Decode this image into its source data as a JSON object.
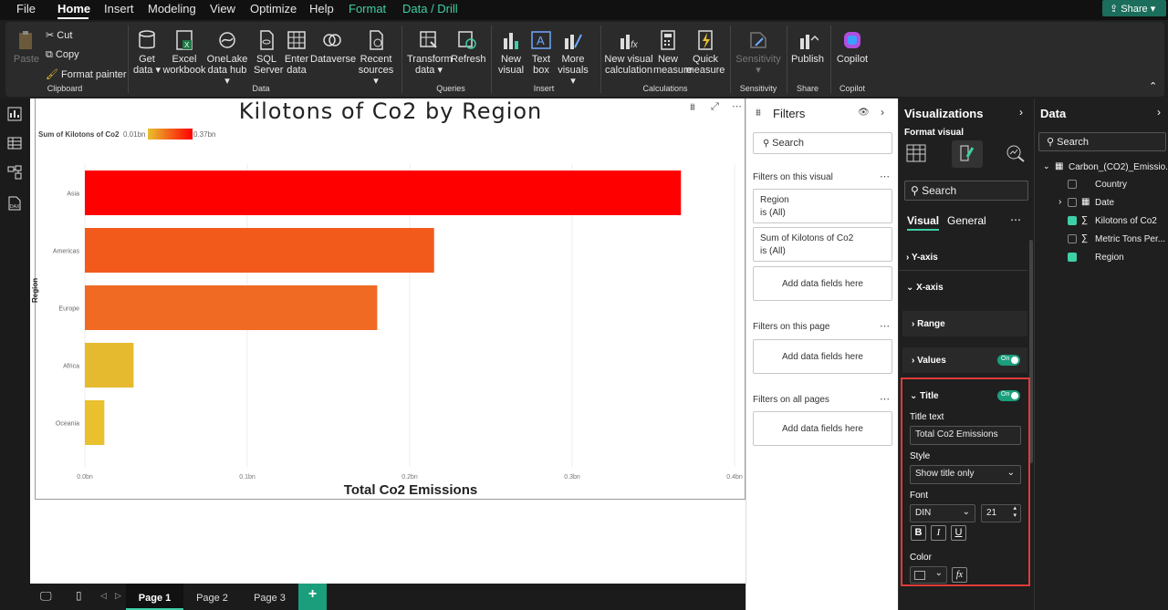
{
  "menu": {
    "items": [
      "File",
      "Home",
      "Insert",
      "Modeling",
      "View",
      "Optimize",
      "Help",
      "Format",
      "Data / Drill"
    ],
    "active": "Home",
    "share_label": "Share"
  },
  "ribbon": {
    "paste": "Paste",
    "cut": "Cut",
    "copy": "Copy",
    "format_painter": "Format painter",
    "get_data": "Get data",
    "excel": "Excel workbook",
    "onelake": "OneLake data hub",
    "sql": "SQL Server",
    "enter_data": "Enter data",
    "dataverse": "Dataverse",
    "recent": "Recent sources",
    "transform": "Transform data",
    "refresh": "Refresh",
    "new_visual": "New visual",
    "text_box": "Text box",
    "more_visuals": "More visuals",
    "new_visual_calc": "New visual calculation",
    "new_measure": "New measure",
    "quick_measure": "Quick measure",
    "sensitivity": "Sensitivity",
    "publish": "Publish",
    "copilot": "Copilot",
    "groups": {
      "clipboard": "Clipboard",
      "data": "Data",
      "queries": "Queries",
      "insert": "Insert",
      "calculations": "Calculations",
      "sensitivity": "Sensitivity",
      "share": "Share",
      "copilot": "Copilot"
    }
  },
  "chart_data": {
    "type": "bar",
    "orientation": "horizontal",
    "title": "Kilotons of Co2 by Region",
    "xlabel": "Total Co2 Emissions",
    "ylabel": "Region",
    "legend_title": "Sum of Kilotons of Co2",
    "legend_min": "0.01bn",
    "legend_max": "0.37bn",
    "categories": [
      "Asia",
      "Americas",
      "Europe",
      "Africa",
      "Oceania"
    ],
    "values": [
      0.367,
      0.215,
      0.18,
      0.03,
      0.012
    ],
    "colors": [
      "#ff0000",
      "#f25a1c",
      "#f06a24",
      "#e5ba2f",
      "#e9c02e"
    ],
    "xlim": [
      0,
      0.4
    ],
    "ticks": [
      "0.0bn",
      "0.1bn",
      "0.2bn",
      "0.3bn",
      "0.4bn"
    ]
  },
  "filters": {
    "title": "Filters",
    "on_visual_label": "Filters on this visual",
    "region_filter": "Region",
    "region_value": "is (All)",
    "sum_filter": "Sum of Kilotons of Co2",
    "sum_value": "is (All)",
    "add_fields": "Add data fields here",
    "on_page_label": "Filters on this page",
    "on_all_label": "Filters on all pages",
    "search_placeholder": "Search"
  },
  "viz": {
    "title": "Visualizations",
    "format_visual": "Format visual",
    "search_placeholder": "Search",
    "tab_visual": "Visual",
    "tab_general": "General",
    "y_axis": "Y-axis",
    "x_axis": "X-axis",
    "range": "Range",
    "values": "Values",
    "on": "On",
    "title_section": "Title",
    "title_text_label": "Title text",
    "title_text_value": "Total Co2 Emissions",
    "style_label": "Style",
    "style_value": "Show title only",
    "font_label": "Font",
    "font_value": "DIN",
    "font_size": "21",
    "bold": "B",
    "italic": "I",
    "underline": "U",
    "color_label": "Color",
    "fx": "fx"
  },
  "data_pane": {
    "title": "Data",
    "search_placeholder": "Search",
    "table": "Carbon_(CO2)_Emissio...",
    "fields": [
      {
        "name": "Country",
        "checked": false,
        "sigma": false
      },
      {
        "name": "Date",
        "checked": false,
        "sigma": false
      },
      {
        "name": "Kilotons of Co2",
        "checked": true,
        "sigma": true
      },
      {
        "name": "Metric Tons Per...",
        "checked": false,
        "sigma": true
      },
      {
        "name": "Region",
        "checked": true,
        "sigma": false
      }
    ]
  },
  "pages": [
    "Page 1",
    "Page 2",
    "Page 3"
  ],
  "active_page": "Page 1",
  "add_page": "+"
}
